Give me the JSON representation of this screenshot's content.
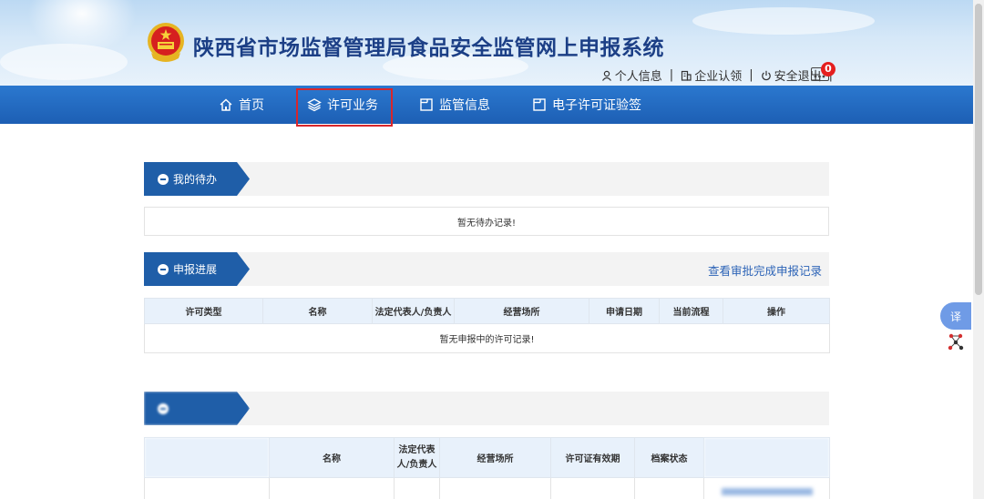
{
  "header": {
    "title": "陕西省市场监督管理局食品安全监管网上申报系统",
    "links": [
      {
        "icon": "user-icon",
        "label": "个人信息"
      },
      {
        "icon": "building-icon",
        "label": "企业认领"
      },
      {
        "icon": "power-icon",
        "label": "安全退出"
      }
    ],
    "message_count": "0"
  },
  "nav": [
    {
      "icon": "home-icon",
      "label": "首页"
    },
    {
      "icon": "layers-icon",
      "label": "许可业务",
      "highlighted": true
    },
    {
      "icon": "folder-icon",
      "label": "监管信息"
    },
    {
      "icon": "folder-icon",
      "label": "电子许可证验签"
    }
  ],
  "todo": {
    "title": "我的待办",
    "empty_text": "暂无待办记录!"
  },
  "progress": {
    "title": "申报进展",
    "link": "查看审批完成申报记录",
    "columns": [
      "许可类型",
      "名称",
      "法定代表人/负责人",
      "经营场所",
      "申请日期",
      "当前流程",
      "操作"
    ],
    "empty_text": "暂无申报中的许可记录!"
  },
  "licenses": {
    "columns": [
      "",
      "名称",
      "法定代表人/负责人",
      "经营场所",
      "许可证有效期",
      "档案状态",
      ""
    ]
  },
  "float": {
    "translate": "译"
  },
  "colors": {
    "nav_bg": "#1d5fb4",
    "section_tag": "#1f5ea8",
    "link": "#2d64b7",
    "highlight": "#d8262b",
    "badge": "#e51f1f"
  }
}
